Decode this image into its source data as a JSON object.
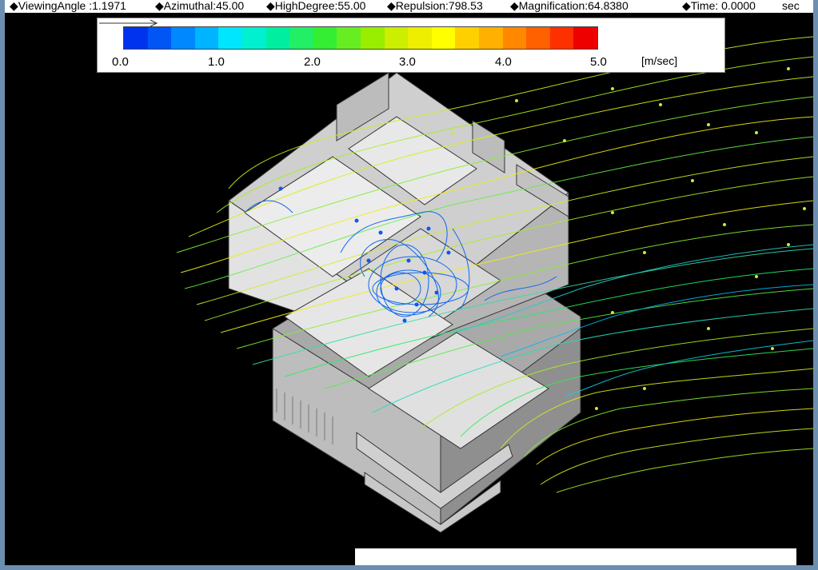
{
  "status": {
    "viewing_angle": "◆ViewingAngle :1.1971",
    "azimuthal": "◆Azimuthal:45.00",
    "high_degree": "◆HighDegree:55.00",
    "repulsion": "◆Repulsion:798.53",
    "magnification": "◆Magnification:64.8380",
    "time": "◆Time: 0.0000",
    "time_unit": "sec"
  },
  "legend": {
    "ticks": [
      "0.0",
      "1.0",
      "2.0",
      "3.0",
      "4.0",
      "5.0"
    ],
    "unit": "[m/sec]",
    "colors": [
      "#0033ee",
      "#0055f5",
      "#0088ff",
      "#00b4ff",
      "#00e6ff",
      "#00f0d0",
      "#00eea0",
      "#22ee66",
      "#33ee33",
      "#66ee22",
      "#99ee00",
      "#ccee00",
      "#eeee00",
      "#ffff00",
      "#ffd000",
      "#ffb000",
      "#ff8800",
      "#ff6000",
      "#ff3000",
      "#ee0000"
    ]
  },
  "icons": {
    "arrow": "arrow-right-icon"
  }
}
